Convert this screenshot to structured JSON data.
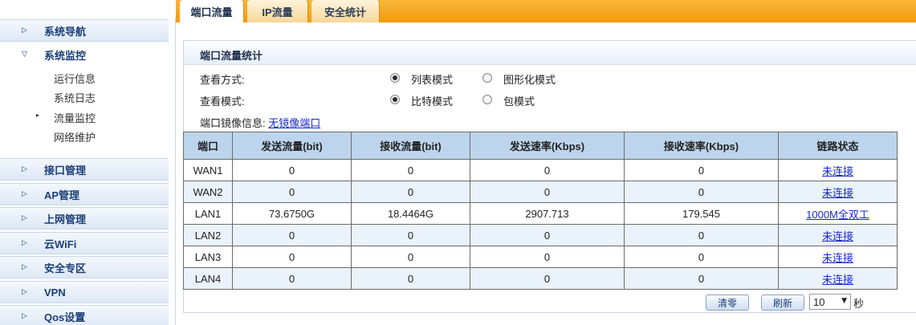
{
  "sidebar": {
    "sections": [
      {
        "label": "系统导航",
        "icon": "arrow-right-icon"
      },
      {
        "label": "系统监控",
        "icon": "arrow-down-icon"
      },
      {
        "label": "接口管理",
        "icon": "arrow-right-icon"
      },
      {
        "label": "AP管理",
        "icon": "arrow-right-icon"
      },
      {
        "label": "上网管理",
        "icon": "arrow-right-icon"
      },
      {
        "label": "云WiFi",
        "icon": "arrow-right-icon"
      },
      {
        "label": "安全专区",
        "icon": "arrow-right-icon"
      },
      {
        "label": "VPN",
        "icon": "arrow-right-icon"
      },
      {
        "label": "Qos设置",
        "icon": "arrow-right-icon"
      }
    ],
    "sub_items": [
      {
        "label": "运行信息"
      },
      {
        "label": "系统日志"
      },
      {
        "label": "流量监控",
        "active": true
      },
      {
        "label": "网络维护"
      }
    ]
  },
  "tabs": [
    {
      "label": "端口流量",
      "active": true
    },
    {
      "label": "IP流量",
      "active": false
    },
    {
      "label": "安全统计",
      "active": false
    }
  ],
  "panel": {
    "title": "端口流量统计",
    "view_method": {
      "label": "查看方式:",
      "options": [
        {
          "label": "列表模式",
          "selected": true
        },
        {
          "label": "图形化模式",
          "selected": false
        }
      ]
    },
    "view_mode": {
      "label": "查看模式:",
      "options": [
        {
          "label": "比特模式",
          "selected": true
        },
        {
          "label": "包模式",
          "selected": false
        }
      ]
    },
    "mirror": {
      "label": "端口镜像信息:",
      "link": "无镜像端口"
    }
  },
  "table": {
    "headers": [
      "端口",
      "发送流量(bit)",
      "接收流量(bit)",
      "发送速率(Kbps)",
      "接收速率(Kbps)",
      "链路状态"
    ],
    "rows": [
      [
        "WAN1",
        "0",
        "0",
        "0",
        "0",
        "未连接"
      ],
      [
        "WAN2",
        "0",
        "0",
        "0",
        "0",
        "未连接"
      ],
      [
        "LAN1",
        "73.6750G",
        "18.4464G",
        "2907.713",
        "179.545",
        "1000M全双工"
      ],
      [
        "LAN2",
        "0",
        "0",
        "0",
        "0",
        "未连接"
      ],
      [
        "LAN3",
        "0",
        "0",
        "0",
        "0",
        "未连接"
      ],
      [
        "LAN4",
        "0",
        "0",
        "0",
        "0",
        "未连接"
      ]
    ]
  },
  "controls": {
    "clear_label": "清零",
    "refresh_label": "刷新",
    "interval_value": "10",
    "interval_unit": "秒"
  },
  "colors": {
    "tab_bar": "#f39a0f",
    "table_header": "#bcd5ec",
    "link": "#1a2ac9",
    "sidebar_text": "#1b3f78"
  }
}
